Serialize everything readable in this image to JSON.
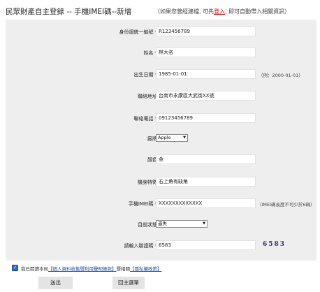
{
  "header": {
    "title": "民眾財產自主登錄 -- 手機IMEI碼--新增",
    "hint_prefix": "（如果您曾經建檔, 可先",
    "login_link": "登入",
    "hint_suffix": ", 即可自動帶入相關資訊）"
  },
  "form": {
    "id_number": {
      "label": "身份證統一編號",
      "value": "R123456789"
    },
    "name": {
      "label": "姓名",
      "value": "林大名"
    },
    "birthdate": {
      "label": "出生日期",
      "value": "1985-01-01",
      "note": "（例：2000-01-01）"
    },
    "address": {
      "label": "聯絡地址",
      "value": "台南市永康區大武街XX號"
    },
    "phone": {
      "label": "聯絡電話",
      "value": "09123456789"
    },
    "brand": {
      "label": "廠牌",
      "selected": "Apple"
    },
    "color": {
      "label": "顏色",
      "value": "金"
    },
    "features": {
      "label": "機身特徵",
      "value": "右上角有缺角"
    },
    "imei": {
      "label": "手機IMEI碼",
      "value": "XXXXXXXXXXXXX",
      "note": "（IMEI碼長度不可少於6碼）"
    },
    "status": {
      "label": "目前狀態",
      "selected": "遺失"
    },
    "captcha": {
      "label": "請輸入驗證碼",
      "value": "6583",
      "code": "6583"
    },
    "required_mark": "*"
  },
  "agreement": {
    "checked": true,
    "prefix": "我已閱讀本局",
    "link1": "【個人資料收集暨利用聲明條款】",
    "middle": "暨相關",
    "link2": "【隱私權政策】"
  },
  "buttons": {
    "submit": "送出",
    "back": "回主選單"
  },
  "colors": {
    "form_bg": "#eeeeee",
    "required": "#d8000f",
    "link": "#1a4fa0",
    "login": "#c00000"
  }
}
